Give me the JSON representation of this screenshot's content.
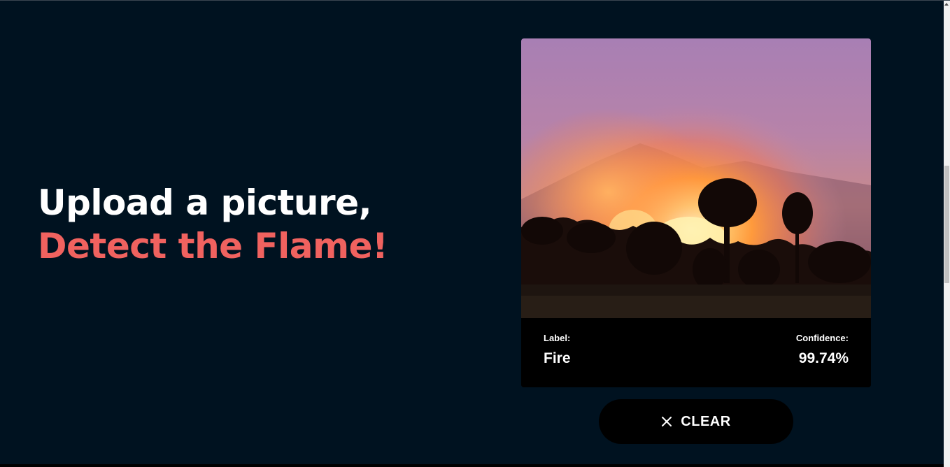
{
  "hero": {
    "line1": "Upload a picture,",
    "line2": "Detect the Flame!"
  },
  "prediction": {
    "label_title": "Label:",
    "label_value": "Fire",
    "confidence_title": "Confidence:",
    "confidence_value": "99.74%"
  },
  "clear_button": {
    "icon": "close-icon",
    "label": "CLEAR"
  },
  "colors": {
    "background": "#001220",
    "accent": "#f0625f",
    "card": "#000000"
  }
}
